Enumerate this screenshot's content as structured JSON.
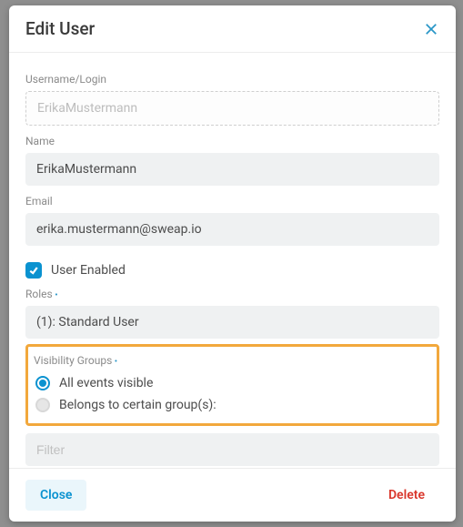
{
  "modal": {
    "title": "Edit User",
    "fields": {
      "username_label": "Username/Login",
      "username_value": "ErikaMustermann",
      "name_label": "Name",
      "name_value": "ErikaMustermann",
      "email_label": "Email",
      "email_value": "erika.mustermann@sweap.io",
      "enabled_label": "User Enabled",
      "enabled_checked": true,
      "roles_label": "Roles",
      "roles_value": "(1): Standard User",
      "visibility_label": "Visibility Groups",
      "visibility_options": {
        "all": "All events visible",
        "groups": "Belongs to certain group(s):"
      },
      "visibility_selected": "all",
      "filter_placeholder": "Filter"
    },
    "footer": {
      "close": "Close",
      "delete": "Delete"
    }
  }
}
